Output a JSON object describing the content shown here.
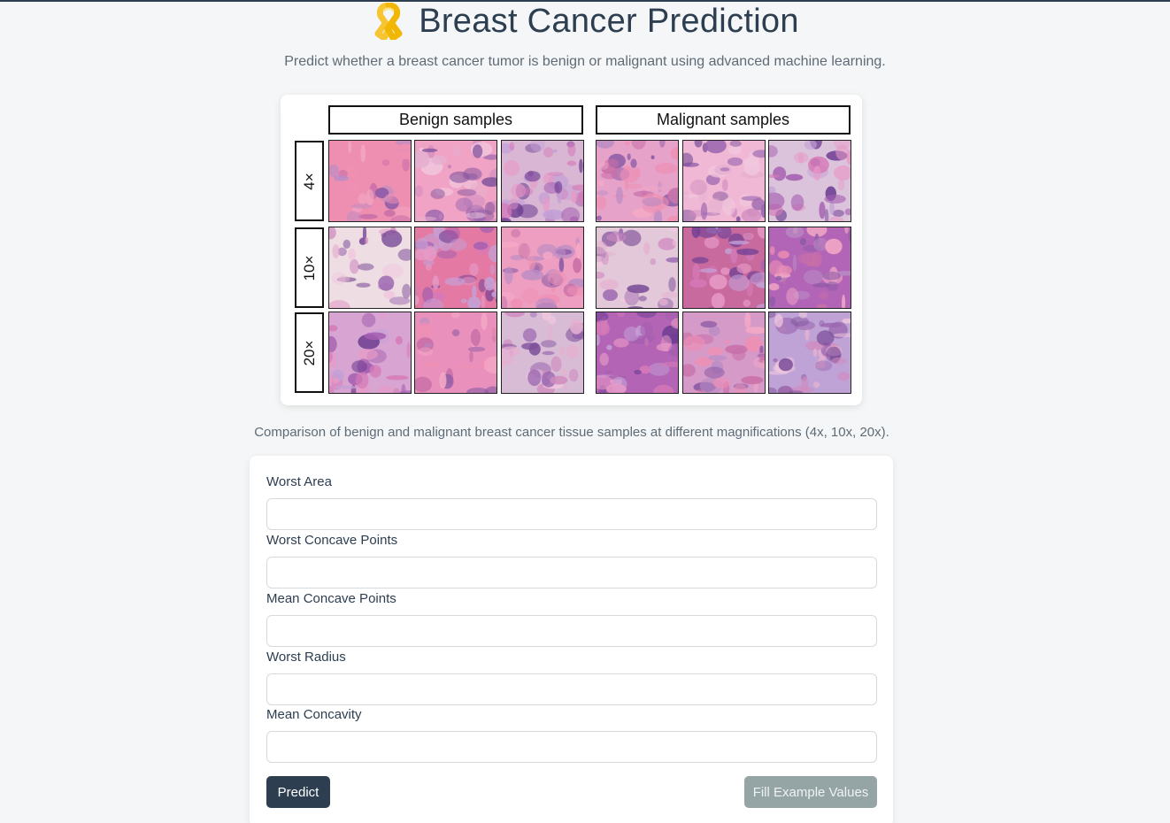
{
  "header": {
    "icon": "awareness-ribbon-icon",
    "ribbon_color": "#f7c531",
    "title": "Breast Cancer Prediction",
    "subtitle": "Predict whether a breast cancer tumor is benign or malignant using advanced machine learning."
  },
  "figure": {
    "benign_header": "Benign samples",
    "malignant_header": "Malignant samples",
    "row_labels": [
      "4×",
      "10×",
      "20×"
    ],
    "caption": "Comparison of benign and malignant breast cancer tissue samples at different magnifications (4x, 10x, 20x)."
  },
  "form": {
    "fields": [
      {
        "label": "Worst Area",
        "value": ""
      },
      {
        "label": "Worst Concave Points",
        "value": ""
      },
      {
        "label": "Mean Concave Points",
        "value": ""
      },
      {
        "label": "Worst Radius",
        "value": ""
      },
      {
        "label": "Mean Concavity",
        "value": ""
      }
    ],
    "predict_label": "Predict",
    "example_label": "Fill Example Values"
  },
  "colors": {
    "primary": "#2c3e50",
    "secondary": "#95a5a6"
  }
}
